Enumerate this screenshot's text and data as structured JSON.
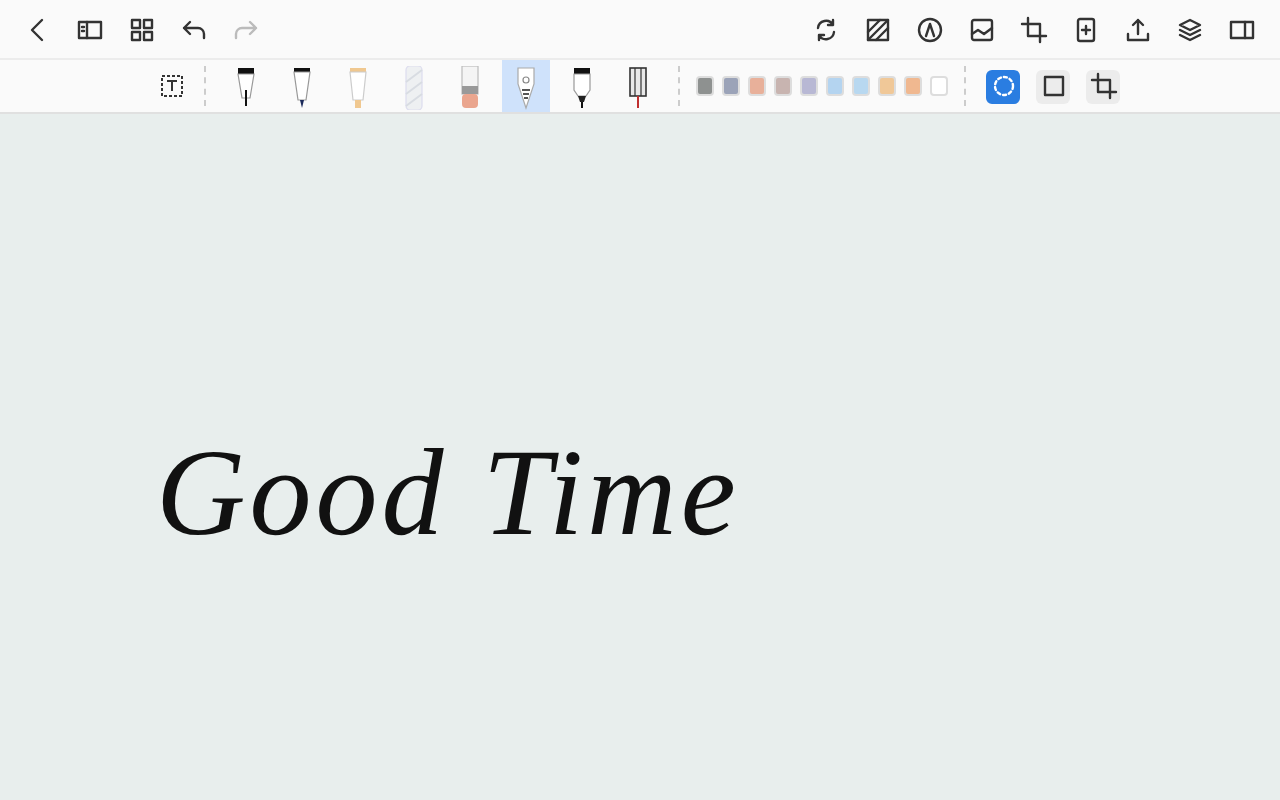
{
  "top_left_actions": [
    {
      "kind": "back",
      "disabled": false
    },
    {
      "kind": "sidebar",
      "disabled": false
    },
    {
      "kind": "grid",
      "disabled": false
    },
    {
      "kind": "undo",
      "disabled": false
    },
    {
      "kind": "redo",
      "disabled": true
    }
  ],
  "top_right_actions": [
    {
      "kind": "sync"
    },
    {
      "kind": "texture"
    },
    {
      "kind": "pen-circle"
    },
    {
      "kind": "image"
    },
    {
      "kind": "crop"
    },
    {
      "kind": "add-page"
    },
    {
      "kind": "share"
    },
    {
      "kind": "layers"
    },
    {
      "kind": "panel"
    }
  ],
  "pens": [
    {
      "kind": "fountain",
      "selected": false
    },
    {
      "kind": "fineliner",
      "selected": false
    },
    {
      "kind": "highlighter",
      "selected": false
    },
    {
      "kind": "pattern",
      "selected": false
    },
    {
      "kind": "eraser",
      "selected": false
    },
    {
      "kind": "pencil",
      "selected": true
    },
    {
      "kind": "marker",
      "selected": false
    },
    {
      "kind": "brush",
      "selected": false
    }
  ],
  "colors": [
    {
      "color": "#8e9190",
      "selected": false
    },
    {
      "color": "#9ba3b8",
      "selected": false
    },
    {
      "color": "#e8b09a",
      "selected": false
    },
    {
      "color": "#c8b4b0",
      "selected": false
    },
    {
      "color": "#b8b8d4",
      "selected": false
    },
    {
      "color": "#b4d4f0",
      "selected": false
    },
    {
      "color": "#b8d8f0",
      "selected": false
    },
    {
      "color": "#f0c898",
      "selected": false
    },
    {
      "color": "#f0b890",
      "selected": false
    },
    {
      "color": "#ffffff",
      "selected": false
    }
  ],
  "select_modes": [
    {
      "kind": "lasso",
      "selected": true
    },
    {
      "kind": "rect",
      "selected": false
    },
    {
      "kind": "crop",
      "selected": false
    }
  ],
  "canvas": {
    "ink_text": "Good Time"
  }
}
